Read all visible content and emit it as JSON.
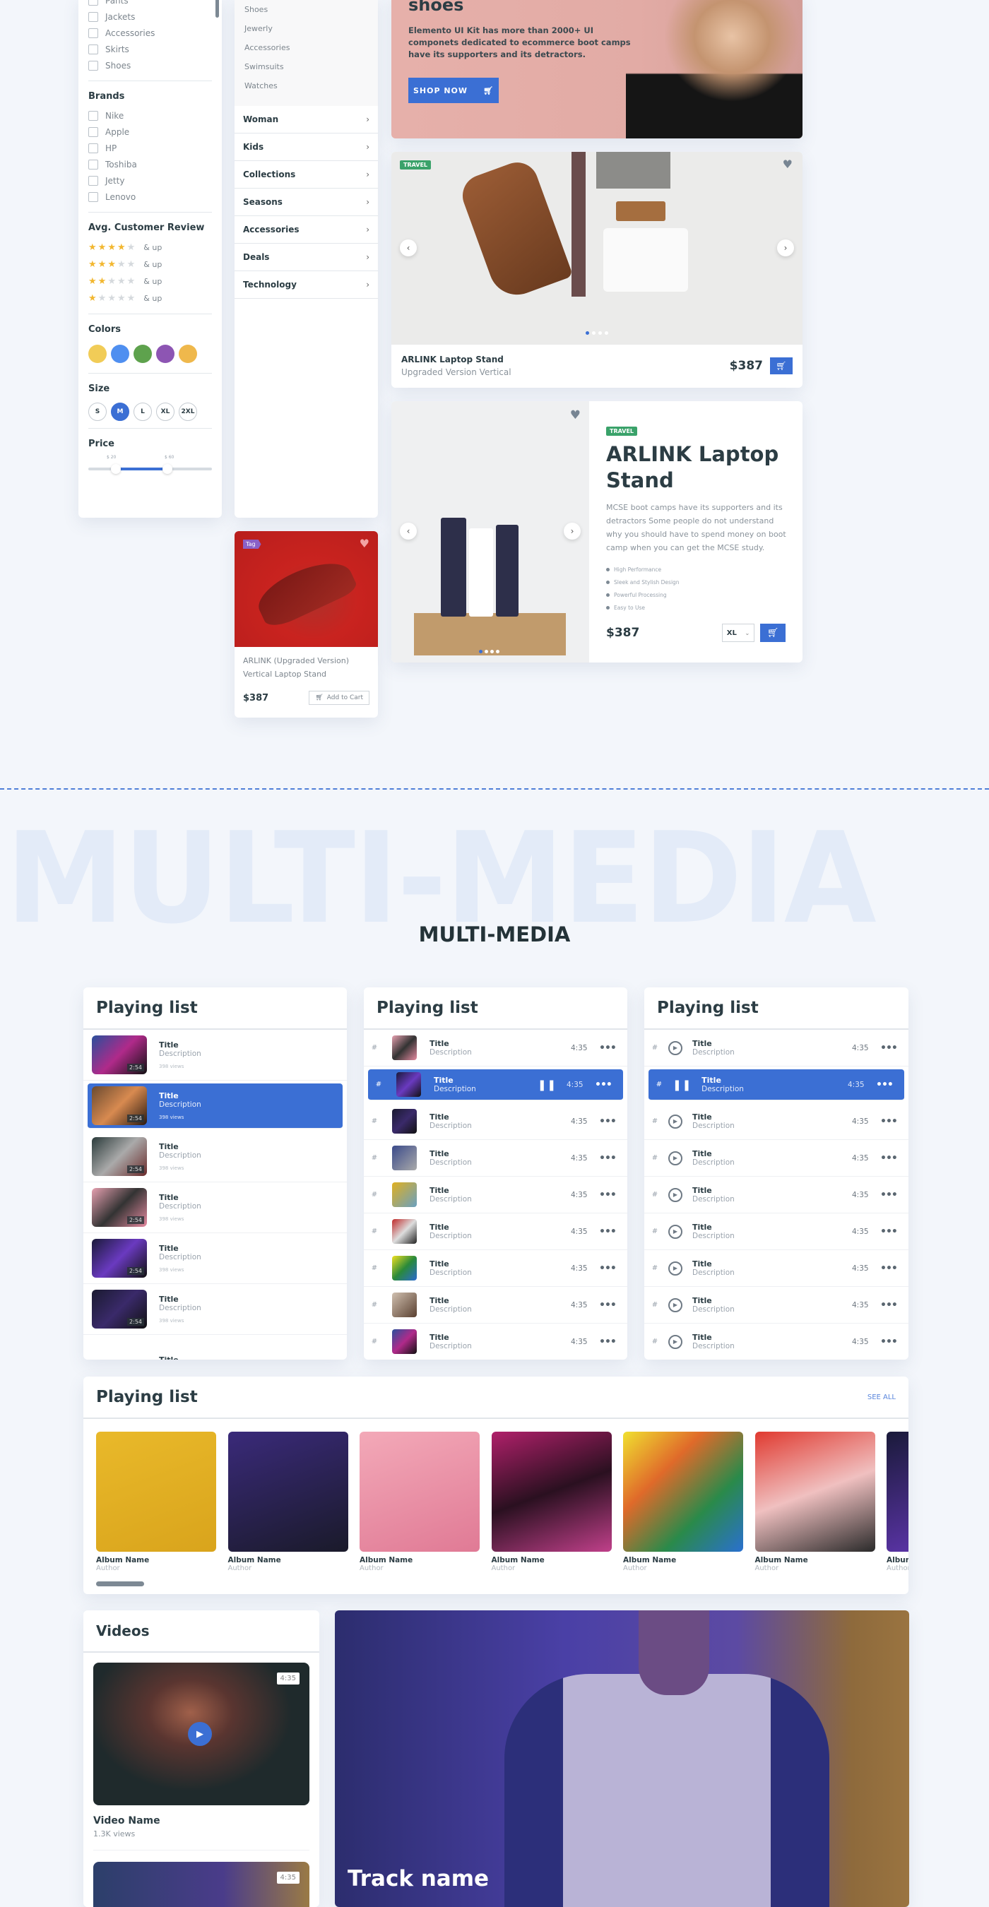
{
  "filters": {
    "categories": [
      "Pants",
      "Jackets",
      "Accessories",
      "Skirts",
      "Shoes"
    ],
    "brands_title": "Brands",
    "brands": [
      "Nike",
      "Apple",
      "HP",
      "Toshiba",
      "Jetty",
      "Lenovo"
    ],
    "review_title": "Avg. Customer Review",
    "reviews": [
      {
        "stars": 4,
        "label": "& up"
      },
      {
        "stars": 3,
        "label": "& up"
      },
      {
        "stars": 2,
        "label": "& up"
      },
      {
        "stars": 1,
        "label": "& up"
      }
    ],
    "colors_title": "Colors",
    "colors": [
      "#f1cc57",
      "#4f8ff0",
      "#5ea24d",
      "#8d55b3",
      "#efb84c"
    ],
    "size_title": "Size",
    "sizes": [
      "S",
      "M",
      "L",
      "XL",
      "2XL"
    ],
    "selected_size": "M",
    "price_title": "Price",
    "price_min": "$ 20",
    "price_max": "$ 60"
  },
  "category_menu": {
    "sub_items": [
      "Shoes",
      "Jewerly",
      "Accessories",
      "Swimsuits",
      "Watches"
    ],
    "items": [
      "Woman",
      "Kids",
      "Collections",
      "Seasons",
      "Accessories",
      "Deals",
      "Technology"
    ]
  },
  "hero": {
    "title": "shoes",
    "text": "Elemento UI Kit has more than 2000+ UI componets dedicated to ecommerce boot camps have its supporters and its detractors.",
    "button": "SHOP NOW"
  },
  "travel_card": {
    "tag": "TRAVEL",
    "name": "ARLINK Laptop Stand",
    "subtitle": "Upgraded Version Vertical",
    "price": "$387"
  },
  "sneaker_card": {
    "tag": "Tag",
    "name": "ARLINK (Upgraded Version) Vertical Laptop Stand",
    "price": "$387",
    "button": "Add to Cart"
  },
  "product_detail": {
    "tag": "TRAVEL",
    "title": "ARLINK Laptop Stand",
    "description": "MCSE boot camps have its supporters and its detractors Some people do not understand why you should have to spend money on boot camp when you can get the MCSE study.",
    "features": [
      "High Performance",
      "Sleek and Stylish Design",
      "Powerful Processing",
      "Easy to Use"
    ],
    "price": "$387",
    "size": "XL"
  },
  "section": {
    "watermark": "MULTI-MEDIA",
    "title": "MULTI-MEDIA"
  },
  "playlist_video": {
    "title": "Playing list",
    "items": [
      {
        "title": "Title",
        "desc": "Description",
        "views": "398 views",
        "dur": "2:54"
      },
      {
        "title": "Title",
        "desc": "Description",
        "views": "398 views",
        "dur": "2:54",
        "active": true
      },
      {
        "title": "Title",
        "desc": "Description",
        "views": "398 views",
        "dur": "2:54"
      },
      {
        "title": "Title",
        "desc": "Description",
        "views": "398 views",
        "dur": "2:54"
      },
      {
        "title": "Title",
        "desc": "Description",
        "views": "398 views",
        "dur": "2:54"
      },
      {
        "title": "Title",
        "desc": "Description",
        "views": "398 views",
        "dur": "2:54"
      },
      {
        "title": "Title",
        "desc": "",
        "views": "",
        "dur": ""
      }
    ]
  },
  "playlist_thumbs": {
    "title": "Playing list",
    "items": [
      {
        "num": "#",
        "title": "Title",
        "desc": "Description",
        "dur": "4:35"
      },
      {
        "num": "#",
        "title": "Title",
        "desc": "Description",
        "dur": "4:35",
        "active": true
      },
      {
        "num": "#",
        "title": "Title",
        "desc": "Description",
        "dur": "4:35"
      },
      {
        "num": "#",
        "title": "Title",
        "desc": "Description",
        "dur": "4:35"
      },
      {
        "num": "#",
        "title": "Title",
        "desc": "Description",
        "dur": "4:35"
      },
      {
        "num": "#",
        "title": "Title",
        "desc": "Description",
        "dur": "4:35"
      },
      {
        "num": "#",
        "title": "Title",
        "desc": "Description",
        "dur": "4:35"
      },
      {
        "num": "#",
        "title": "Title",
        "desc": "Description",
        "dur": "4:35"
      },
      {
        "num": "#",
        "title": "Title",
        "desc": "Description",
        "dur": "4:35"
      }
    ]
  },
  "playlist_icons": {
    "title": "Playing list",
    "items": [
      {
        "num": "#",
        "title": "Title",
        "desc": "Description",
        "dur": "4:35"
      },
      {
        "num": "#",
        "title": "Title",
        "desc": "Description",
        "dur": "4:35",
        "active": true
      },
      {
        "num": "#",
        "title": "Title",
        "desc": "Description",
        "dur": "4:35"
      },
      {
        "num": "#",
        "title": "Title",
        "desc": "Description",
        "dur": "4:35"
      },
      {
        "num": "#",
        "title": "Title",
        "desc": "Description",
        "dur": "4:35"
      },
      {
        "num": "#",
        "title": "Title",
        "desc": "Description",
        "dur": "4:35"
      },
      {
        "num": "#",
        "title": "Title",
        "desc": "Description",
        "dur": "4:35"
      },
      {
        "num": "#",
        "title": "Title",
        "desc": "Description",
        "dur": "4:35"
      },
      {
        "num": "#",
        "title": "Title",
        "desc": "Description",
        "dur": "4:35"
      }
    ]
  },
  "albums": {
    "title": "Playing list",
    "see_all": "SEE ALL",
    "items": [
      {
        "name": "Album Name",
        "author": "Author"
      },
      {
        "name": "Album Name",
        "author": "Author"
      },
      {
        "name": "Album Name",
        "author": "Author"
      },
      {
        "name": "Album Name",
        "author": "Author"
      },
      {
        "name": "Album Name",
        "author": "Author"
      },
      {
        "name": "Album Name",
        "author": "Author"
      },
      {
        "name": "Album Name",
        "author": "Author"
      }
    ]
  },
  "videos": {
    "title": "Videos",
    "items": [
      {
        "name": "Video Name",
        "views": "1.3K views",
        "dur": "4:35"
      },
      {
        "dur": "4:35"
      }
    ]
  },
  "track": {
    "name": "Track name"
  },
  "accent": "#3b6fd4"
}
